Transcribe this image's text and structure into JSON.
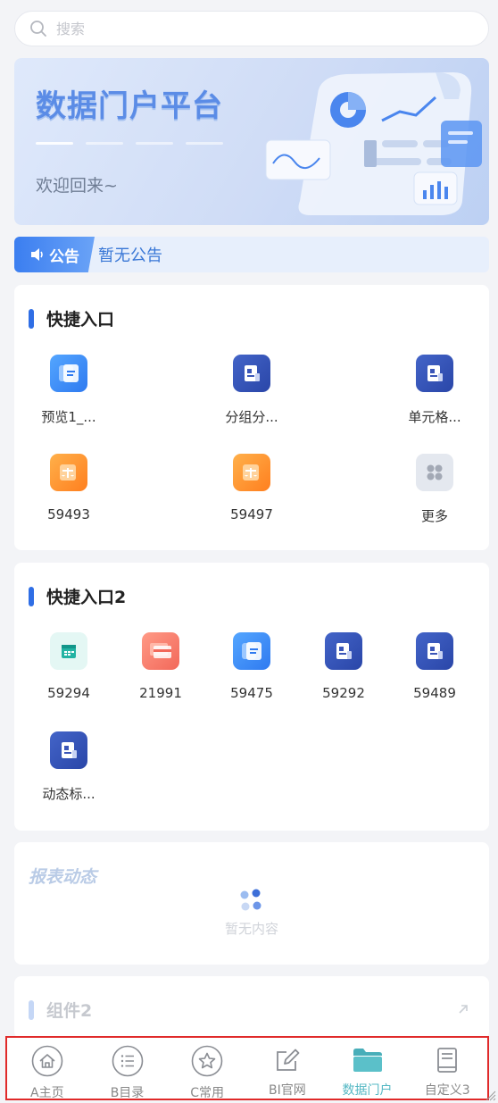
{
  "search": {
    "placeholder": "搜索"
  },
  "banner": {
    "title": "数据门户平台",
    "subtitle": "欢迎回来~"
  },
  "notice": {
    "tag": "公告",
    "text": "暂无公告"
  },
  "quick1": {
    "title": "快捷入口",
    "items": [
      {
        "label": "预览1_...",
        "icon": "stack-doc-icon"
      },
      {
        "label": "分组分...",
        "icon": "report-doc-icon"
      },
      {
        "label": "单元格...",
        "icon": "report-doc-icon"
      },
      {
        "label": "59493",
        "icon": "scale-icon"
      },
      {
        "label": "59497",
        "icon": "scale-icon"
      },
      {
        "label": "更多",
        "icon": "grid-more-icon"
      }
    ]
  },
  "quick2": {
    "title": "快捷入口2",
    "items": [
      {
        "label": "59294",
        "icon": "calendar-icon"
      },
      {
        "label": "21991",
        "icon": "credit-card-icon"
      },
      {
        "label": "59475",
        "icon": "stack-doc-icon"
      },
      {
        "label": "59292",
        "icon": "report-doc-icon"
      },
      {
        "label": "59489",
        "icon": "report-doc-icon"
      },
      {
        "label": "动态标...",
        "icon": "report-doc-icon"
      }
    ]
  },
  "report": {
    "title": "报表动态",
    "empty": "暂无内容"
  },
  "widget": {
    "title": "组件2"
  },
  "tabbar": {
    "items": [
      {
        "label": "A主页",
        "icon": "home-icon"
      },
      {
        "label": "B目录",
        "icon": "list-icon"
      },
      {
        "label": "C常用",
        "icon": "star-icon"
      },
      {
        "label": "BI官网",
        "icon": "edit-icon"
      },
      {
        "label": "数据门户",
        "icon": "folder-icon",
        "active": true
      },
      {
        "label": "自定义3",
        "icon": "document-icon"
      }
    ]
  },
  "colors": {
    "accent": "#2f6ee5",
    "active_tab": "#55b8c4",
    "highlight_border": "#e02a2a"
  }
}
